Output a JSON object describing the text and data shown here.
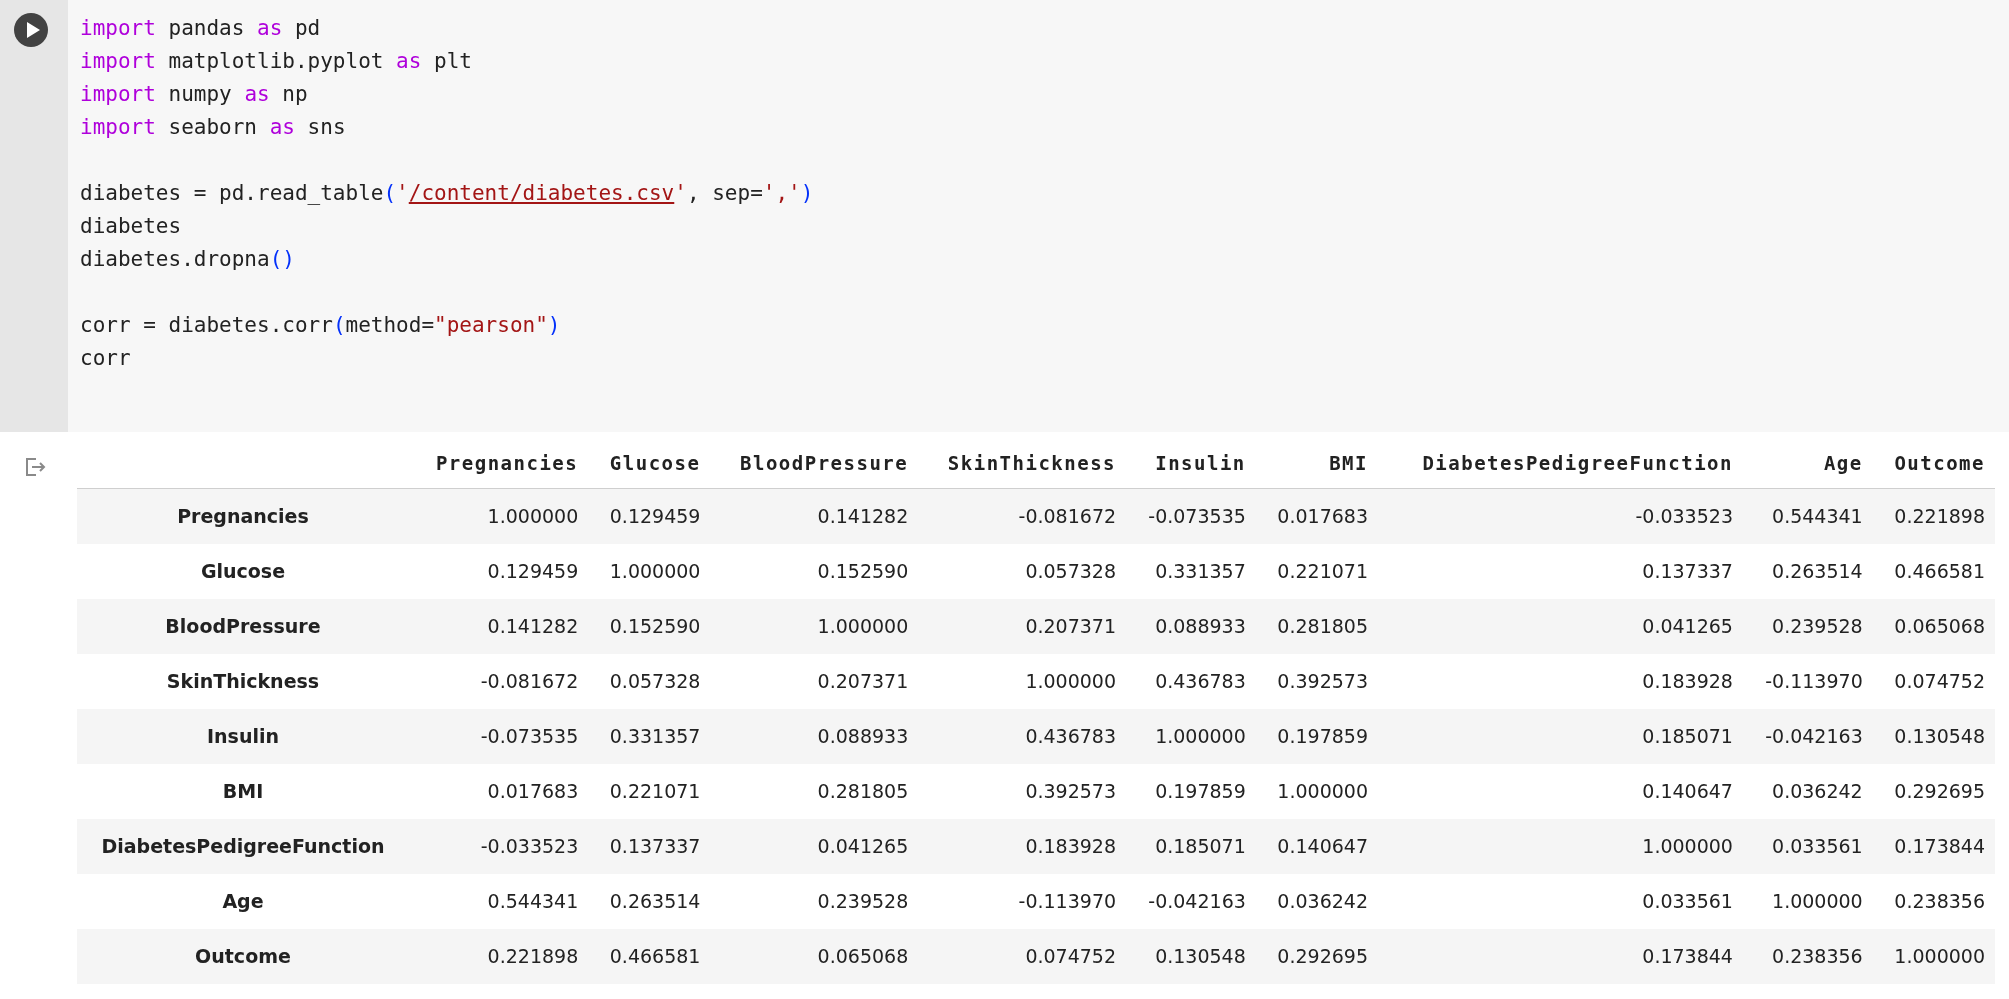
{
  "code_cell": {
    "code_blocks": [
      [
        [
          {
            "kind": "keyword",
            "text": "import"
          },
          {
            "kind": "plain",
            "text": " pandas "
          },
          {
            "kind": "keyword",
            "text": "as"
          },
          {
            "kind": "plain",
            "text": " pd"
          }
        ],
        [
          {
            "kind": "keyword",
            "text": "import"
          },
          {
            "kind": "plain",
            "text": " matplotlib.pyplot "
          },
          {
            "kind": "keyword",
            "text": "as"
          },
          {
            "kind": "plain",
            "text": " plt"
          }
        ],
        [
          {
            "kind": "keyword",
            "text": "import"
          },
          {
            "kind": "plain",
            "text": " numpy "
          },
          {
            "kind": "keyword",
            "text": "as"
          },
          {
            "kind": "plain",
            "text": " np"
          }
        ],
        [
          {
            "kind": "keyword",
            "text": "import"
          },
          {
            "kind": "plain",
            "text": " seaborn "
          },
          {
            "kind": "keyword",
            "text": "as"
          },
          {
            "kind": "plain",
            "text": " sns"
          }
        ]
      ],
      [
        [
          {
            "kind": "plain",
            "text": "diabetes = pd.read_table"
          },
          {
            "kind": "paren",
            "text": "("
          },
          {
            "kind": "quote",
            "text": "'"
          },
          {
            "kind": "link",
            "text": "/content/diabetes.csv"
          },
          {
            "kind": "quote",
            "text": "'"
          },
          {
            "kind": "plain",
            "text": ", sep="
          },
          {
            "kind": "string",
            "text": "','"
          },
          {
            "kind": "paren",
            "text": ")"
          }
        ],
        [
          {
            "kind": "plain",
            "text": "diabetes"
          }
        ],
        [
          {
            "kind": "plain",
            "text": "diabetes.dropna"
          },
          {
            "kind": "paren",
            "text": "()"
          }
        ]
      ],
      [
        [
          {
            "kind": "plain",
            "text": "corr = diabetes.corr"
          },
          {
            "kind": "paren",
            "text": "("
          },
          {
            "kind": "plain",
            "text": "method="
          },
          {
            "kind": "string",
            "text": "\"pearson\""
          },
          {
            "kind": "paren",
            "text": ")"
          }
        ],
        [
          {
            "kind": "plain",
            "text": "corr"
          }
        ]
      ]
    ]
  },
  "output": {
    "table": {
      "columns": [
        "Pregnancies",
        "Glucose",
        "BloodPressure",
        "SkinThickness",
        "Insulin",
        "BMI",
        "DiabetesPedigreeFunction",
        "Age",
        "Outcome"
      ],
      "rows": [
        {
          "label": "Pregnancies",
          "values": [
            "1.000000",
            "0.129459",
            "0.141282",
            "-0.081672",
            "-0.073535",
            "0.017683",
            "-0.033523",
            "0.544341",
            "0.221898"
          ]
        },
        {
          "label": "Glucose",
          "values": [
            "0.129459",
            "1.000000",
            "0.152590",
            "0.057328",
            "0.331357",
            "0.221071",
            "0.137337",
            "0.263514",
            "0.466581"
          ]
        },
        {
          "label": "BloodPressure",
          "values": [
            "0.141282",
            "0.152590",
            "1.000000",
            "0.207371",
            "0.088933",
            "0.281805",
            "0.041265",
            "0.239528",
            "0.065068"
          ]
        },
        {
          "label": "SkinThickness",
          "values": [
            "-0.081672",
            "0.057328",
            "0.207371",
            "1.000000",
            "0.436783",
            "0.392573",
            "0.183928",
            "-0.113970",
            "0.074752"
          ]
        },
        {
          "label": "Insulin",
          "values": [
            "-0.073535",
            "0.331357",
            "0.088933",
            "0.436783",
            "1.000000",
            "0.197859",
            "0.185071",
            "-0.042163",
            "0.130548"
          ]
        },
        {
          "label": "BMI",
          "values": [
            "0.017683",
            "0.221071",
            "0.281805",
            "0.392573",
            "0.197859",
            "1.000000",
            "0.140647",
            "0.036242",
            "0.292695"
          ]
        },
        {
          "label": "DiabetesPedigreeFunction",
          "values": [
            "-0.033523",
            "0.137337",
            "0.041265",
            "0.183928",
            "0.185071",
            "0.140647",
            "1.000000",
            "0.033561",
            "0.173844"
          ]
        },
        {
          "label": "Age",
          "values": [
            "0.544341",
            "0.263514",
            "0.239528",
            "-0.113970",
            "-0.042163",
            "0.036242",
            "0.033561",
            "1.000000",
            "0.238356"
          ]
        },
        {
          "label": "Outcome",
          "values": [
            "0.221898",
            "0.466581",
            "0.065068",
            "0.074752",
            "0.130548",
            "0.292695",
            "0.173844",
            "0.238356",
            "1.000000"
          ]
        }
      ]
    }
  }
}
